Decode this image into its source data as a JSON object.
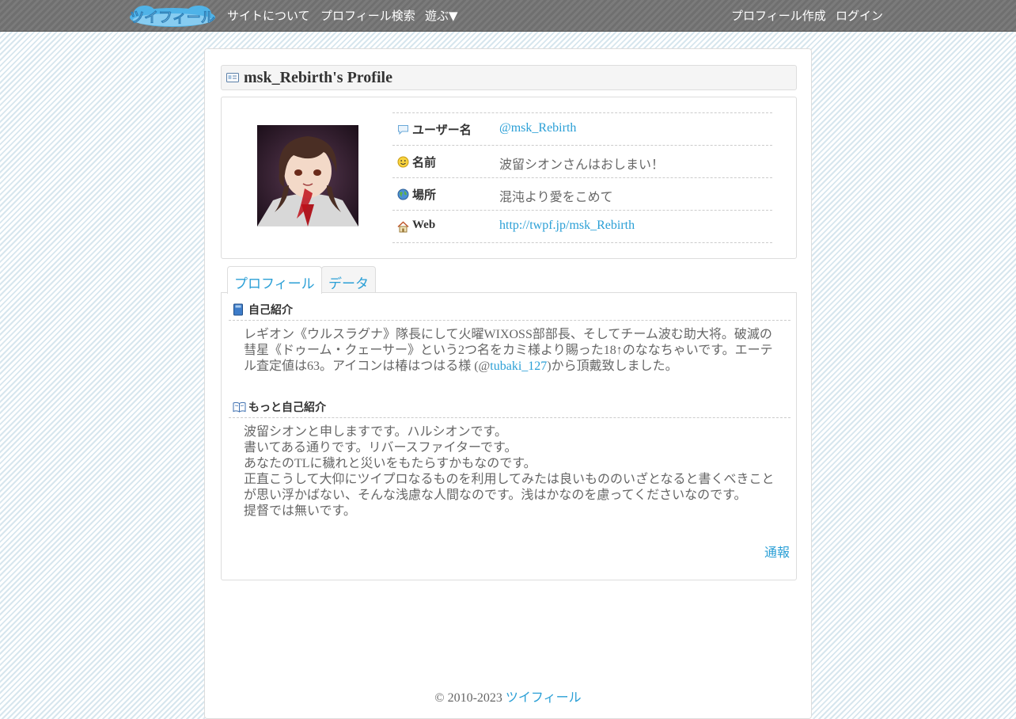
{
  "nav": {
    "logo_text": "ツイフィール",
    "about": "サイトについて",
    "search": "プロフィール検索",
    "play": "遊ぶ▼",
    "create": "プロフィール作成",
    "login": "ログイン"
  },
  "profile": {
    "title": "msk_Rebirth's Profile",
    "fields": [
      {
        "icon": "speech-bubble-icon",
        "label": "ユーザー名",
        "value": "@msk_Rebirth"
      },
      {
        "icon": "smiley-icon",
        "label": "名前",
        "value": "波留シオンさんはおしまい！"
      },
      {
        "icon": "globe-icon",
        "label": "場所",
        "value": "混沌より愛をこめて"
      },
      {
        "icon": "home-icon",
        "label": "Web",
        "value": "http://twpf.jp/msk_Rebirth"
      }
    ]
  },
  "tabs": {
    "profile": "プロフィール",
    "data": "データ"
  },
  "bio": {
    "title": "自己紹介",
    "text_before": "レギオン《ウルスラグナ》隊長にして火曜WIXOSS部部長、そしてチーム波む助大将。破滅の彗星《ドゥーム・クェーサー》という2つ名をカミ様より賜った18↑のななちゃいです。エーテル査定値は63。アイコンは椿はつはる様 (@",
    "link": "tubaki_127",
    "text_after": ")から頂戴致しました。"
  },
  "more": {
    "title": "もっと自己紹介",
    "lines": [
      "波留シオンと申しますです。ハルシオンです。",
      "書いてある通りです。リバースファイターです。",
      "あなたのTLに穢れと災いをもたらすかもなのです。",
      "正直こうして大仰にツイプロなるものを利用してみたは良いもののいざとなると書くべきことが思い浮かばない、そんな浅慮な人間なのです。浅はかなのを慮ってくださいなのです。",
      "提督では無いです。"
    ]
  },
  "report": "通報",
  "footer": {
    "copyright": "© 2010-2023 ",
    "site": "ツイフィール"
  }
}
